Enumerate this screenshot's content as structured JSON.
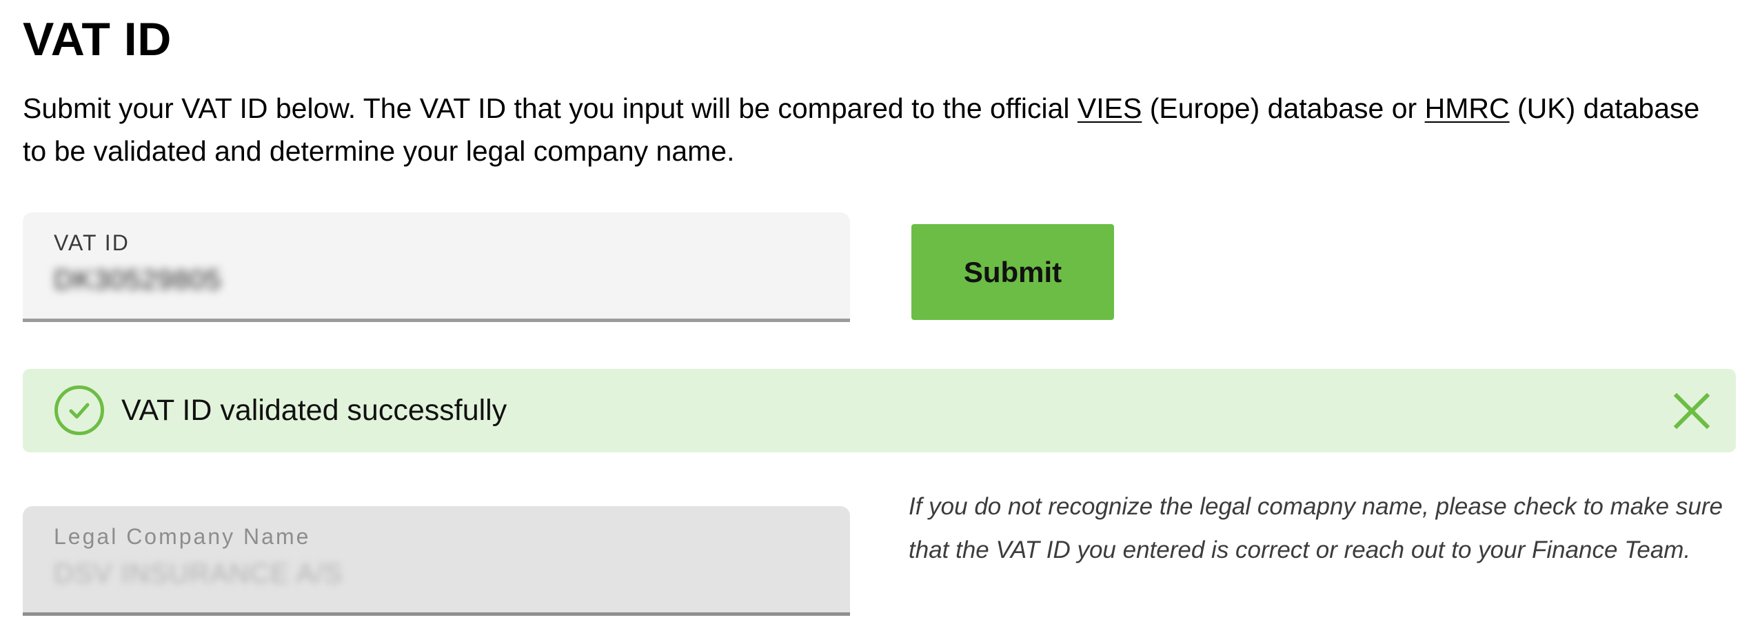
{
  "page": {
    "title": "VAT ID"
  },
  "intro": {
    "text_before_vies": "Submit your VAT ID below. The VAT ID that you input will be compared to the official ",
    "vies_link": "VIES",
    "text_between": " (Europe) database or ",
    "hmrc_link": "HMRC",
    "text_after": " (UK) database to be validated and determine your legal company name."
  },
  "vat_field": {
    "label": "VAT ID",
    "value": "DK30529805"
  },
  "submit_button": {
    "label": "Submit"
  },
  "alert": {
    "message": "VAT ID validated successfully",
    "status": "success",
    "icon": "check-circle-icon",
    "close_icon": "close-icon"
  },
  "company_field": {
    "label": "Legal Company Name",
    "value": "DSV INSURANCE A/S",
    "disabled": true
  },
  "hint": {
    "text": "If you do not recognize the legal comapny name, please check to make sure that the VAT ID you entered is correct or reach out to your Finance Team."
  },
  "colors": {
    "accent": "#6cbd45",
    "success_background": "#e2f3db",
    "field_background": "#f4f4f4",
    "disabled_field_background": "#e3e3e3"
  }
}
